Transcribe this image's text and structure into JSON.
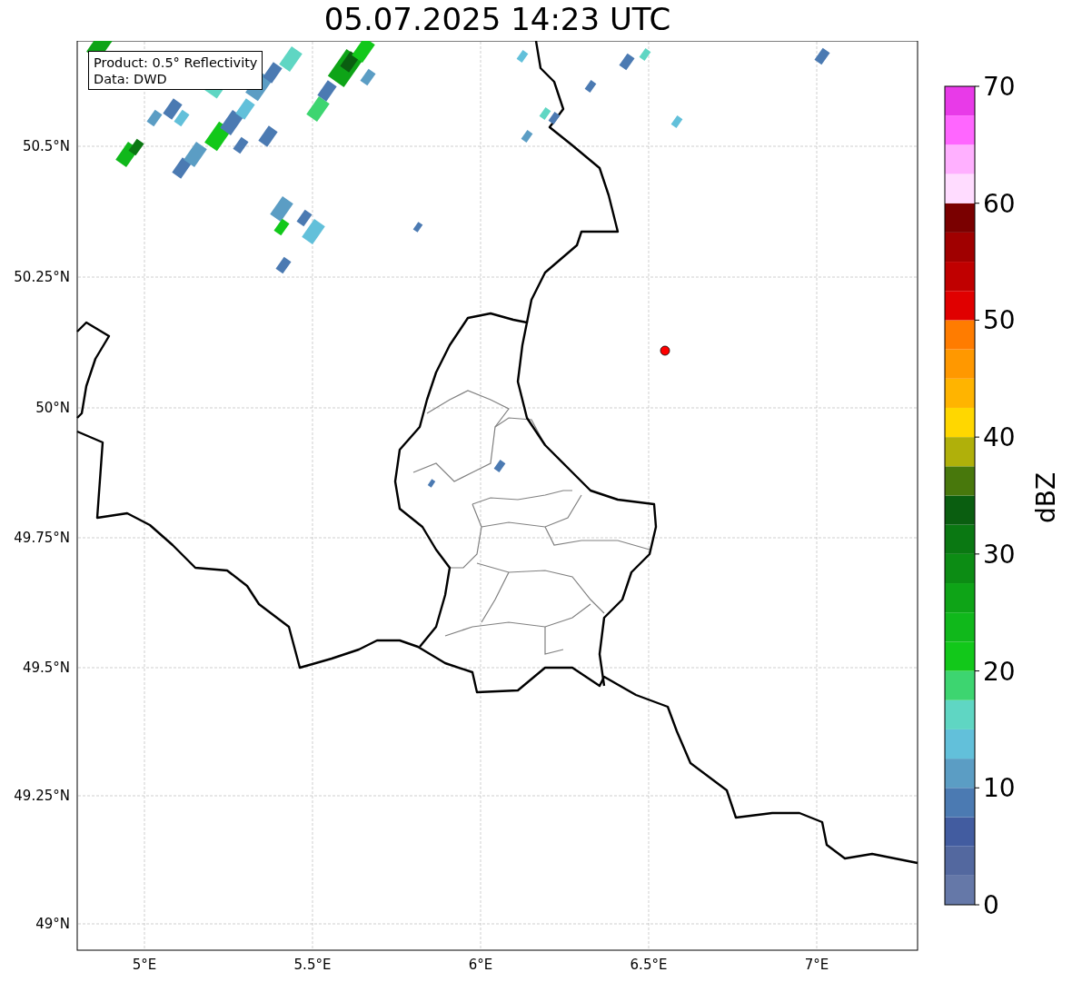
{
  "title": "05.07.2025 14:23 UTC",
  "info_box": {
    "lines": [
      "Product: 0.5° Reflectivity",
      "Data: DWD"
    ]
  },
  "map": {
    "x_ticks": [
      "5°E",
      "5.5°E",
      "6°E",
      "6.5°E",
      "7°E"
    ],
    "y_ticks": [
      "50.5°N",
      "50.25°N",
      "50°N",
      "49.75°N",
      "49.5°N",
      "49.25°N",
      "49°N"
    ]
  },
  "colorbar": {
    "label": "dBZ",
    "ticks": [
      "70",
      "60",
      "50",
      "40",
      "30",
      "20",
      "10",
      "0"
    ],
    "bins": [
      {
        "color": "#6578a8"
      },
      {
        "color": "#53689f"
      },
      {
        "color": "#425ca0"
      },
      {
        "color": "#4b7ab2"
      },
      {
        "color": "#5b9dc4"
      },
      {
        "color": "#62c0da"
      },
      {
        "color": "#5fd6c3"
      },
      {
        "color": "#3dd570"
      },
      {
        "color": "#12c81a"
      },
      {
        "color": "#10b81b"
      },
      {
        "color": "#0ea417"
      },
      {
        "color": "#0c8c14"
      },
      {
        "color": "#0a7812"
      },
      {
        "color": "#0a5e10"
      },
      {
        "color": "#48780c"
      },
      {
        "color": "#b0b00a"
      },
      {
        "color": "#ffd700"
      },
      {
        "color": "#ffb400"
      },
      {
        "color": "#ff9800"
      },
      {
        "color": "#ff7c00"
      },
      {
        "color": "#e00000"
      },
      {
        "color": "#c00000"
      },
      {
        "color": "#a00000"
      },
      {
        "color": "#7a0000"
      },
      {
        "color": "#ffdcff"
      },
      {
        "color": "#ffb0ff"
      },
      {
        "color": "#ff66ff"
      },
      {
        "color": "#e83ae8"
      }
    ]
  }
}
